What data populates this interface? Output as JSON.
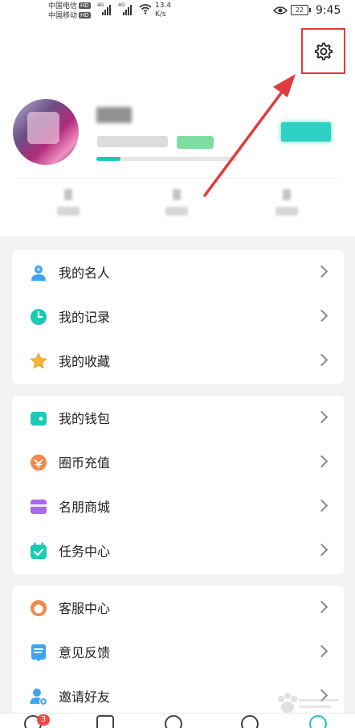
{
  "status_bar": {
    "carrier1": "中国电信",
    "carrier2": "中国移动",
    "hd": "HD",
    "net1": "4G",
    "net2": "4G",
    "speed_value": "13.4",
    "speed_unit": "K/s",
    "battery": "22",
    "time": "9:45"
  },
  "profile": {
    "settings_icon": "gear-icon"
  },
  "menu_groups": [
    [
      {
        "label": "我的名人",
        "icon": "person-icon",
        "color": "#3ba4f5"
      },
      {
        "label": "我的记录",
        "icon": "clock-icon",
        "color": "#1cc9b7"
      },
      {
        "label": "我的收藏",
        "icon": "star-icon",
        "color": "#f7b733"
      }
    ],
    [
      {
        "label": "我的钱包",
        "icon": "wallet-icon",
        "color": "#1cc9b7"
      },
      {
        "label": "圈币充值",
        "icon": "coin-icon",
        "color": "#f2894a"
      },
      {
        "label": "名朋商城",
        "icon": "shop-icon",
        "color": "#a56af0"
      },
      {
        "label": "任务中心",
        "icon": "calendar-check-icon",
        "color": "#1cc9b7"
      }
    ],
    [
      {
        "label": "客服中心",
        "icon": "headset-icon",
        "color": "#f2894a"
      },
      {
        "label": "意见反馈",
        "icon": "feedback-icon",
        "color": "#3ba4f5"
      },
      {
        "label": "邀请好友",
        "icon": "invite-user-icon",
        "color": "#3ba4f5"
      }
    ]
  ],
  "bottom_nav": {
    "badge_count": "3"
  },
  "colors": {
    "accent": "#1cc9b7",
    "highlight": "#e23b3b"
  }
}
